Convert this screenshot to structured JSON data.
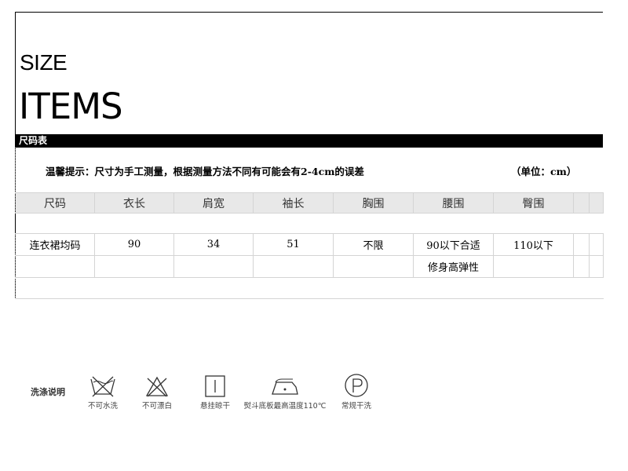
{
  "header": {
    "size": "SIZE",
    "items": "ITEMS",
    "table_title": "尺码表"
  },
  "notice": {
    "tip": "温馨提示：尺寸为手工测量，根据测量方法不同有可能会有2-4cm的误差",
    "unit": "（单位：cm）"
  },
  "size_table": {
    "columns": [
      "尺码",
      "衣长",
      "肩宽",
      "袖长",
      "胸围",
      "腰围",
      "臀围",
      "",
      ""
    ],
    "rows": [
      [
        "连衣裙均码",
        "90",
        "34",
        "51",
        "不限",
        "90以下合适",
        "110以下",
        "",
        ""
      ],
      [
        "",
        "",
        "",
        "",
        "",
        "修身高弹性",
        "",
        "",
        ""
      ]
    ]
  },
  "washing": {
    "title": "洗涤说明",
    "items": [
      {
        "icon": "no-water-wash-icon",
        "label": "不可水洗"
      },
      {
        "icon": "no-bleach-icon",
        "label": "不可漂白"
      },
      {
        "icon": "hang-dry-icon",
        "label": "悬挂晾干"
      },
      {
        "icon": "iron-icon",
        "label": "熨斗底板最高温度110℃"
      },
      {
        "icon": "dry-clean-icon",
        "label": "常规干洗"
      }
    ]
  }
}
